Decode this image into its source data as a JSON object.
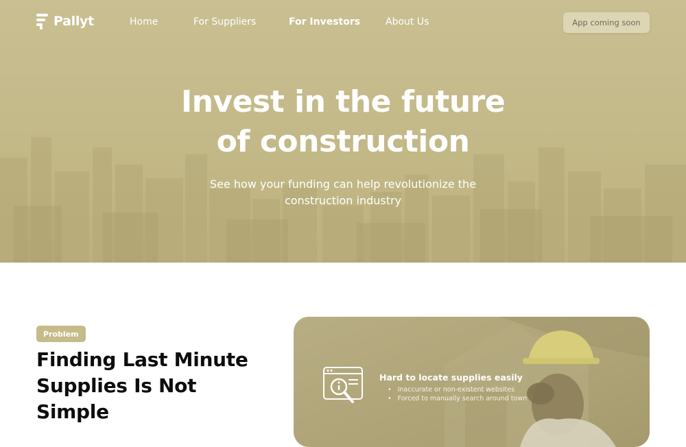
{
  "brand": {
    "name": "Pallyt"
  },
  "nav": {
    "items": [
      {
        "label": "Home",
        "active": false
      },
      {
        "label": "For Suppliers",
        "active": false
      },
      {
        "label": "For Investors",
        "active": true
      },
      {
        "label": "About Us",
        "active": false
      }
    ],
    "cta_label": "App coming soon"
  },
  "hero": {
    "title_line1": "Invest in the future",
    "title_line2": "of construction",
    "subtitle_line1": "See how your funding can help revolutionize the",
    "subtitle_line2": "construction industry"
  },
  "problem": {
    "badge": "Problem",
    "title_line1": "Finding Last Minute",
    "title_line2": "Supplies Is Not",
    "title_line3": "Simple"
  },
  "feature": {
    "title": "Hard to locate supplies easily",
    "bullets": [
      "Inaccurate or non-existent websites",
      "Forced to manually search around town"
    ]
  },
  "colors": {
    "hero_tint": "#c6bb8a",
    "badge": "#c6bb8a",
    "cta_bg": "#ddd6b5",
    "text_dark": "#0d0d0d"
  }
}
